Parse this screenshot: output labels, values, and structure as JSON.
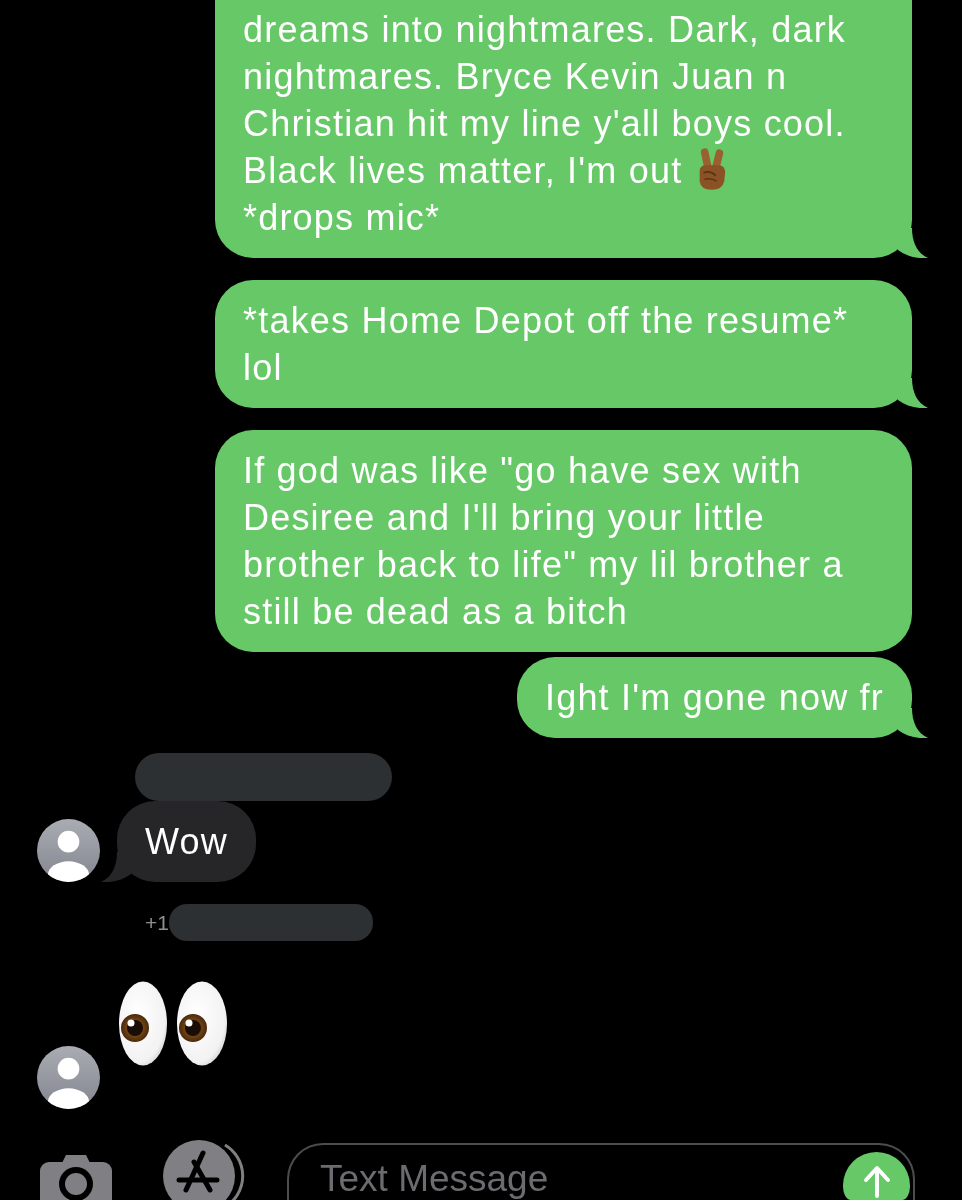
{
  "messages": [
    {
      "outgoing": true,
      "kind": "bubble",
      "tail": true,
      "avatar": false,
      "redacted": false,
      "paragraphs": [
        [
          {
            "kind": "text",
            "text": "dreams into nightmares. Dark, dark nightmares. Bryce Kevin Juan n Christian hit my line y'all boys cool."
          }
        ],
        [
          {
            "kind": "text",
            "text": "Black lives matter, I'm out"
          },
          {
            "kind": "peace"
          },
          {
            "kind": "text",
            "text": "*drops mic*"
          }
        ]
      ]
    },
    {
      "outgoing": true,
      "kind": "bubble",
      "tail": true,
      "avatar": false,
      "redacted": false,
      "paragraphs": [
        [
          {
            "kind": "text",
            "text": "*takes Home Depot off the resume* lol"
          }
        ]
      ]
    },
    {
      "outgoing": true,
      "kind": "bubble",
      "tail": false,
      "avatar": false,
      "redacted": false,
      "paragraphs": [
        [
          {
            "kind": "text",
            "text": "If god was like \"go have sex with Desiree and I'll bring your little brother back to life\" my lil brother a still be dead as a bitch"
          }
        ]
      ]
    },
    {
      "outgoing": true,
      "kind": "bubble",
      "tail": true,
      "avatar": false,
      "redacted": false,
      "paragraphs": [
        [
          {
            "kind": "text",
            "text": "Ight I'm gone now fr"
          }
        ]
      ]
    },
    {
      "outgoing": false,
      "kind": "bubble",
      "tail": true,
      "avatar": true,
      "redacted": true,
      "paragraphs": [
        [
          {
            "kind": "text",
            "text": "Wow"
          }
        ]
      ]
    },
    {
      "outgoing": false,
      "kind": "emoji",
      "avatar": true,
      "redacted": true,
      "sender": "+1",
      "paragraphs": [
        [
          {
            "kind": "eyes"
          }
        ]
      ]
    }
  ],
  "composer": {
    "placeholder": "Text Message"
  }
}
